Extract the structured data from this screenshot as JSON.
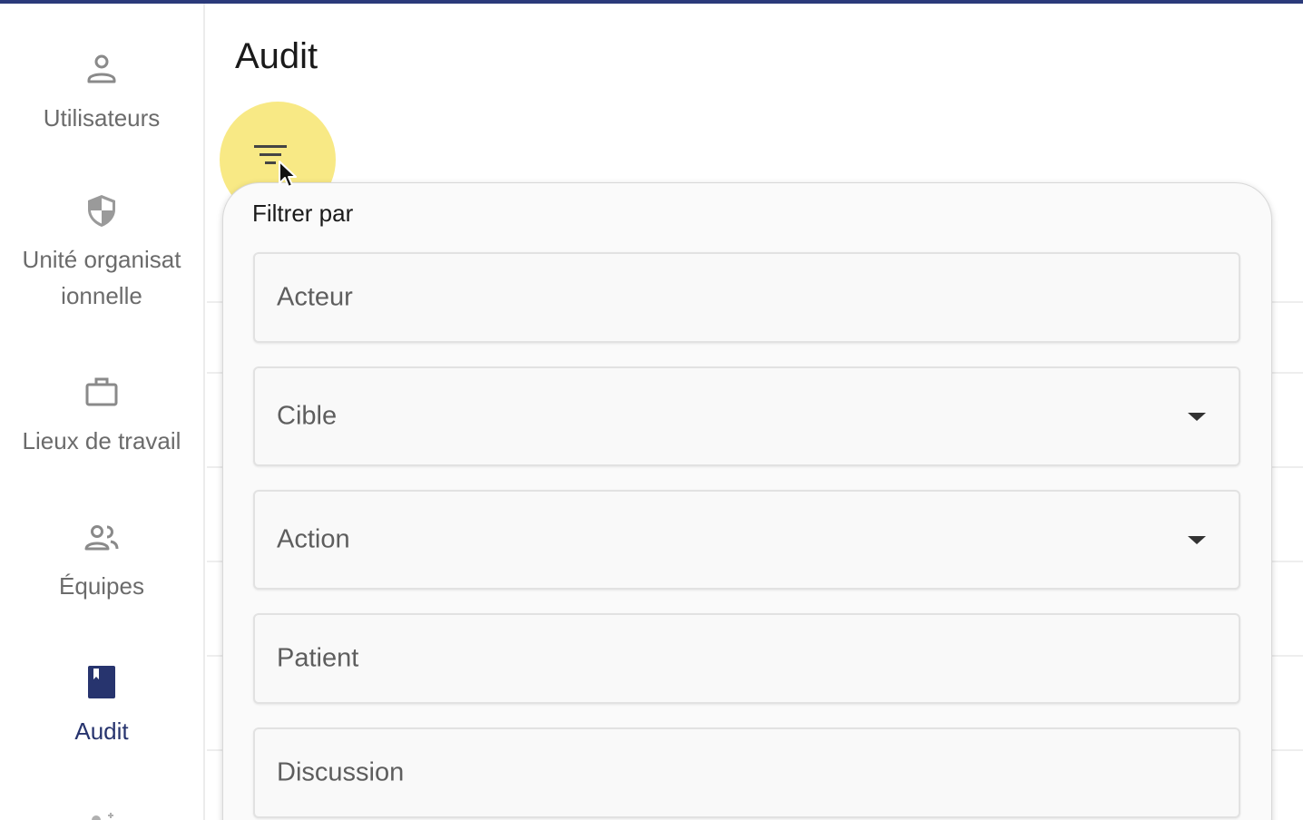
{
  "colors": {
    "accent": "#27346e",
    "topbar": "#2b3a7a",
    "highlight": "#f6e25c",
    "muted_text": "#6b6b6b"
  },
  "sidebar": {
    "items": [
      {
        "label": "Utilisateurs",
        "icon": "person-icon",
        "active": false
      },
      {
        "label": "Unité organisat ionnelle",
        "icon": "shield-icon",
        "active": false
      },
      {
        "label": "Lieux de travail",
        "icon": "briefcase-icon",
        "active": false
      },
      {
        "label": "Équipes",
        "icon": "people-icon",
        "active": false
      },
      {
        "label": "Audit",
        "icon": "book-icon",
        "active": true
      }
    ]
  },
  "main": {
    "title": "Audit",
    "filter_icon": "filter-icon"
  },
  "filter_panel": {
    "title": "Filtrer par",
    "fields": [
      {
        "label": "Acteur",
        "type": "text"
      },
      {
        "label": "Cible",
        "type": "select"
      },
      {
        "label": "Action",
        "type": "select"
      },
      {
        "label": "Patient",
        "type": "text"
      },
      {
        "label": "Discussion",
        "type": "text"
      }
    ]
  }
}
